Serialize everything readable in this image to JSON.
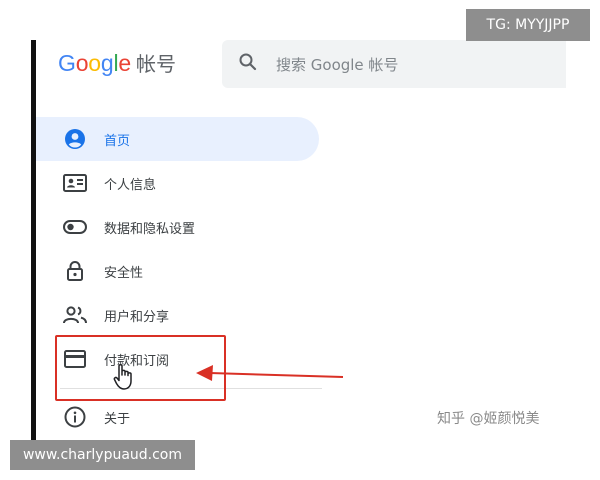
{
  "header": {
    "logo_letters": [
      "G",
      "o",
      "o",
      "g",
      "l",
      "e"
    ],
    "logo_colors": [
      "#4285F4",
      "#EA4335",
      "#FBBC05",
      "#4285F4",
      "#34A853",
      "#EA4335"
    ],
    "account_title": "帐号",
    "search_placeholder": "搜索 Google 帐号",
    "search_icon": "search-icon"
  },
  "nav": {
    "items": [
      {
        "label": "首页",
        "icon": "account-circle-icon",
        "active": true
      },
      {
        "label": "个人信息",
        "icon": "id-card-icon",
        "active": false
      },
      {
        "label": "数据和隐私设置",
        "icon": "toggle-icon",
        "active": false
      },
      {
        "label": "安全性",
        "icon": "lock-icon",
        "active": false
      },
      {
        "label": "用户和分享",
        "icon": "people-icon",
        "active": false
      },
      {
        "label": "付款和订阅",
        "icon": "credit-card-icon",
        "active": false
      },
      {
        "label": "关于",
        "icon": "info-icon",
        "active": false
      }
    ]
  },
  "colors": {
    "accent": "#1a73e8",
    "active_bg": "#e8f0fe",
    "annotation": "#d93025"
  },
  "watermarks": {
    "top_right": "TG: MYYJJPP",
    "bottom_left": "www.charlypuaud.com",
    "zhihu": "知乎 @姬颜悦美"
  }
}
